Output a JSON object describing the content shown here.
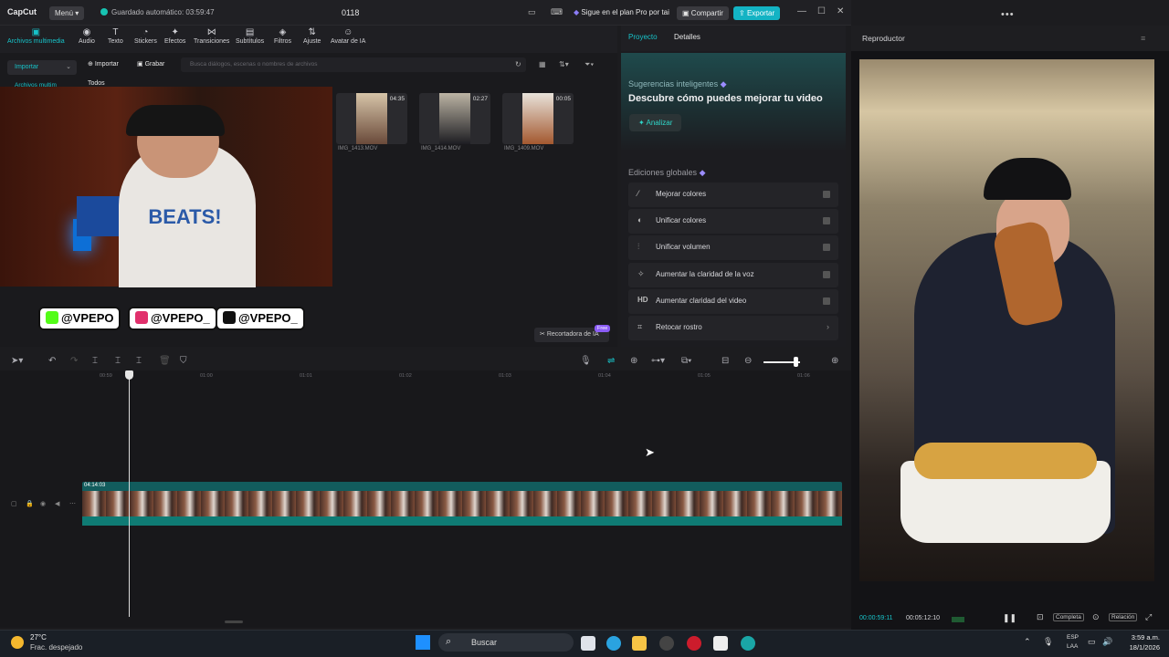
{
  "titlebar": {
    "logo": "CapCut",
    "menu": "Menú",
    "autosave": "Guardado automático: 03:59:47",
    "project_name": "0118",
    "pro_text": "Sigue en el plan Pro por tai",
    "share": "Compartir",
    "export": "Exportar"
  },
  "toolbar": {
    "items": [
      {
        "label": "Archivos multimedia",
        "icon": "media-icon"
      },
      {
        "label": "Audio",
        "icon": "audio-icon"
      },
      {
        "label": "Texto",
        "icon": "text-icon"
      },
      {
        "label": "Stickers",
        "icon": "sticker-icon"
      },
      {
        "label": "Efectos",
        "icon": "effects-icon"
      },
      {
        "label": "Transiciones",
        "icon": "transitions-icon"
      },
      {
        "label": "Subtítulos",
        "icon": "subtitles-icon"
      },
      {
        "label": "Filtros",
        "icon": "filters-icon"
      },
      {
        "label": "Ajuste",
        "icon": "adjust-icon"
      },
      {
        "label": "Avatar de IA",
        "icon": "avatar-icon"
      }
    ]
  },
  "media": {
    "import_side": "Importar",
    "import": "Importar",
    "grab": "Grabar",
    "search_placeholder": "Busca diálogos, escenas o nombres de archivos",
    "tab_all": "Todos",
    "category": "Archivos multim",
    "files": [
      {
        "name": "IMG_1413.MOV",
        "duration": "04:35"
      },
      {
        "name": "IMG_1414.MOV",
        "duration": "02:27"
      },
      {
        "name": "IMG_1409.MOV",
        "duration": "00:05"
      }
    ],
    "socials": [
      "@VPEPO",
      "@VPEPO_",
      "@VPEPO_"
    ],
    "recortadora": "Recortadora de IA",
    "free_badge": "Free"
  },
  "details": {
    "tab_project": "Proyecto",
    "tab_details": "Detalles",
    "smart_title": "Sugerencias inteligentes",
    "smart_head": "Descubre cómo puedes mejorar tu video",
    "analyze": "Analizar",
    "global_title": "Ediciones globales",
    "edits": [
      {
        "label": "Mejorar colores",
        "icon": "wand-icon"
      },
      {
        "label": "Unificar colores",
        "icon": "palette-icon"
      },
      {
        "label": "Unificar volumen",
        "icon": "sliders-icon"
      },
      {
        "label": "Aumentar la claridad de la voz",
        "icon": "voice-icon"
      },
      {
        "label": "Aumentar claridad del video",
        "icon": "hd-icon"
      },
      {
        "label": "Retocar rostro",
        "icon": "face-icon"
      }
    ]
  },
  "timeline": {
    "ticks": [
      "00:59",
      "01:00",
      "01:01",
      "01:02",
      "01:03",
      "01:04",
      "01:05",
      "01:06"
    ],
    "clip_duration": "04:14:03"
  },
  "player": {
    "title": "Reproductor",
    "time_current": "00:00:59:11",
    "time_total": "00:05:12:10",
    "btn_complete": "Completa",
    "btn_ratio": "Relación"
  },
  "taskbar": {
    "temp": "27°C",
    "weather": "Frac. despejado",
    "search": "Buscar",
    "lang1": "ESP",
    "lang2": "LAA",
    "time": "3:59 a.m.",
    "date": "18/1/2026"
  },
  "colors": {
    "accent": "#17c3c9",
    "export": "#13b3c4",
    "clip": "#125c5d"
  }
}
